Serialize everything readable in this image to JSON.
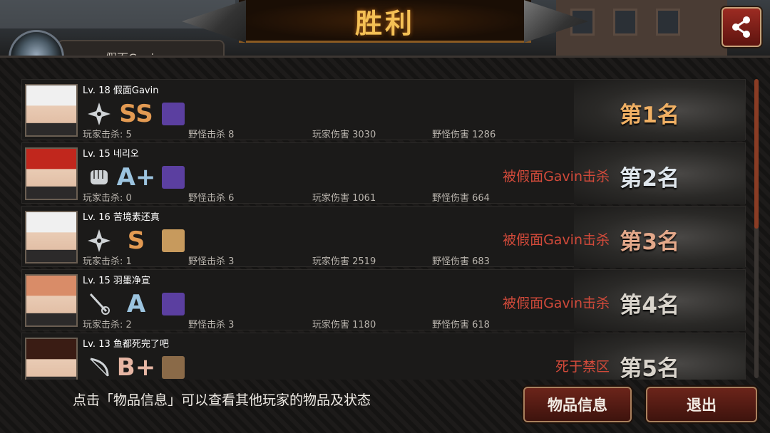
{
  "title": "胜利",
  "player_plate": "假面Gavin",
  "hint": "点击「物品信息」可以查看其他玩家的物品及状态",
  "buttons": {
    "item_info": "物品信息",
    "exit": "退出"
  },
  "share_icon": "share-icon",
  "rows": [
    {
      "lv": "Lv. 18 假面Gavin",
      "weapon": "shuriken-icon",
      "grade": "SS",
      "grade_color": "#e39a52",
      "item": "purple-wolf-icon",
      "item_color": "#5b3fa0",
      "s1": "玩家击杀: 5",
      "s2": "野怪击杀 8",
      "s3": "玩家伤害 3030",
      "s4": "野怪伤害 1286",
      "killer": "",
      "rank": "第1名",
      "avatar_hair": "#f0f0f0"
    },
    {
      "lv": "Lv. 15 네리오",
      "weapon": "fist-icon",
      "grade": "A+",
      "grade_color": "#9cc4df",
      "item": "purple-wolf-icon",
      "item_color": "#5b3fa0",
      "s1": "玩家击杀: 0",
      "s2": "野怪击杀 6",
      "s3": "玩家伤害 1061",
      "s4": "野怪伤害 664",
      "killer": "被假面Gavin击杀",
      "rank": "第2名",
      "avatar_hair": "#c1271d"
    },
    {
      "lv": "Lv. 16 苦境素还真",
      "weapon": "shuriken-icon",
      "grade": "S",
      "grade_color": "#e39a52",
      "item": "map-scroll-icon",
      "item_color": "#c79a5d",
      "s1": "玩家击杀: 1",
      "s2": "野怪击杀 3",
      "s3": "玩家伤害 2519",
      "s4": "野怪伤害 683",
      "killer": "被假面Gavin击杀",
      "rank": "第3名",
      "avatar_hair": "#f0f0f0"
    },
    {
      "lv": "Lv. 15 羽墨净宣",
      "weapon": "rapier-icon",
      "grade": "A",
      "grade_color": "#9cc4df",
      "item": "purple-wolf-icon",
      "item_color": "#5b3fa0",
      "s1": "玩家击杀: 2",
      "s2": "野怪击杀 3",
      "s3": "玩家伤害 1180",
      "s4": "野怪伤害 618",
      "killer": "被假面Gavin击杀",
      "rank": "第4名",
      "avatar_hair": "#d98c68"
    },
    {
      "lv": "Lv. 13 鱼都死完了吧",
      "weapon": "bow-icon",
      "grade": "B+",
      "grade_color": "#e6b6a4",
      "item": "crossed-blades-icon",
      "item_color": "#8a6a48",
      "s1": "",
      "s2": "",
      "s3": "",
      "s4": "",
      "killer": "死于禁区",
      "rank": "第5名",
      "avatar_hair": "#3a1c14"
    }
  ]
}
